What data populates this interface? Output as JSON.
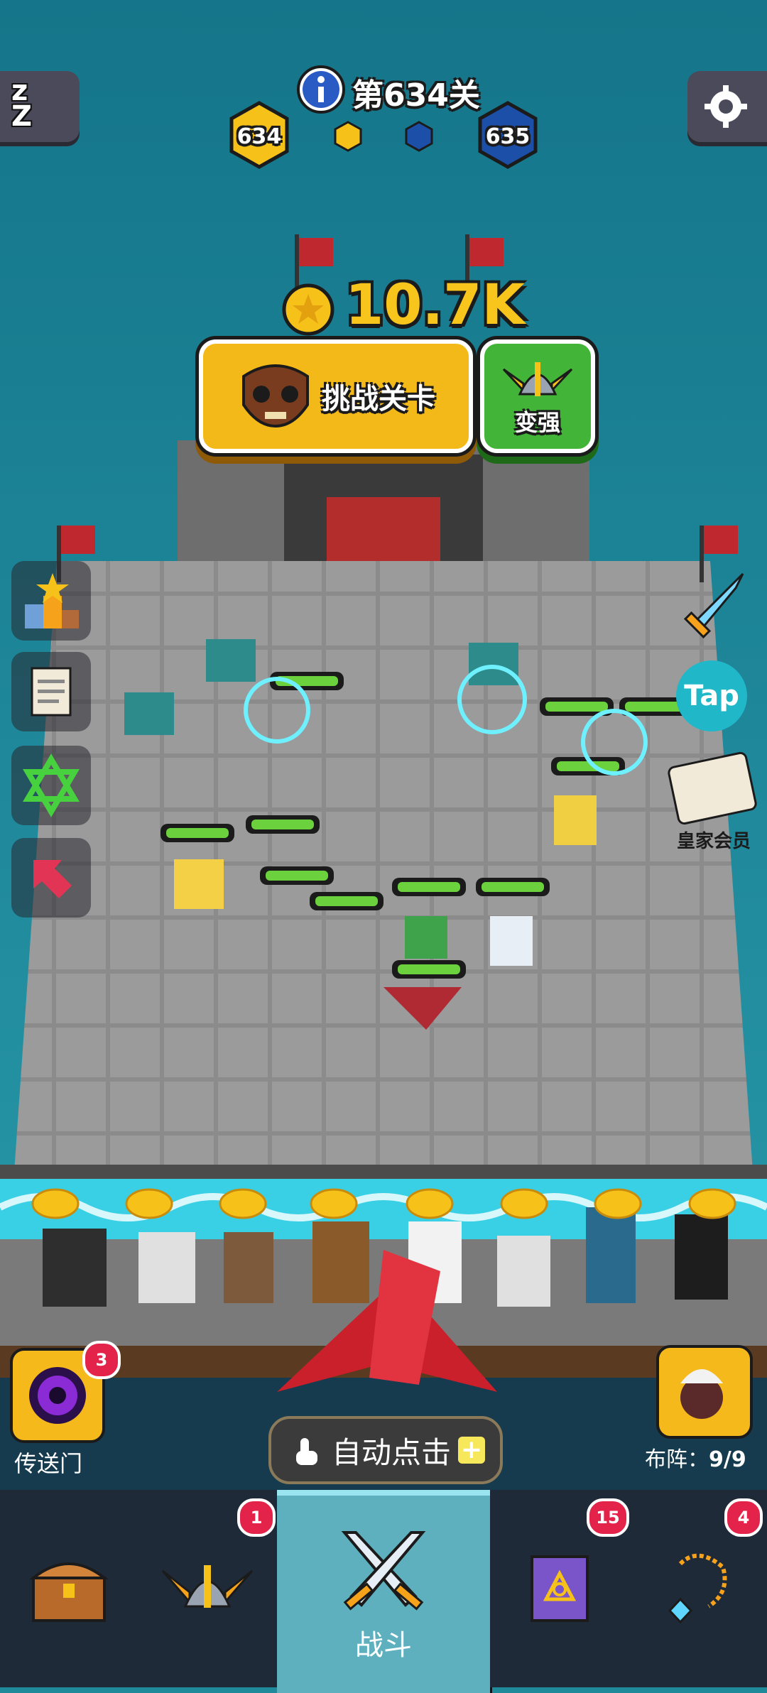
{
  "header": {
    "level_label": "第634关",
    "current_level": "634",
    "next_level": "635"
  },
  "reward": {
    "amount": "10.7K"
  },
  "actions": {
    "challenge_label": "挑战关卡",
    "upgrade_label": "变强"
  },
  "side_right": {
    "tap_label": "Tap",
    "royal_member_label": "皇家会员"
  },
  "bottom": {
    "portal_label": "传送门",
    "portal_badge": "3",
    "auto_click_label": "自动点击",
    "formation_label": "布阵：",
    "formation_value": "9/9"
  },
  "tabs": [
    {
      "name": "treasure",
      "label": "",
      "badge": ""
    },
    {
      "name": "heroes",
      "label": "",
      "badge": "1"
    },
    {
      "name": "battle",
      "label": "战斗",
      "badge": ""
    },
    {
      "name": "spellbook",
      "label": "",
      "badge": "15"
    },
    {
      "name": "artifacts",
      "label": "",
      "badge": "4"
    }
  ],
  "colors": {
    "sky": "#1e8a9a",
    "stone": "#8a8a8a",
    "gold": "#f6c21a",
    "hex_blue": "#1c4fa8",
    "green": "#42b437",
    "badge_red": "#e4234a",
    "tab_bg": "#1f2a38",
    "active_tab": "#6fb8c4"
  }
}
